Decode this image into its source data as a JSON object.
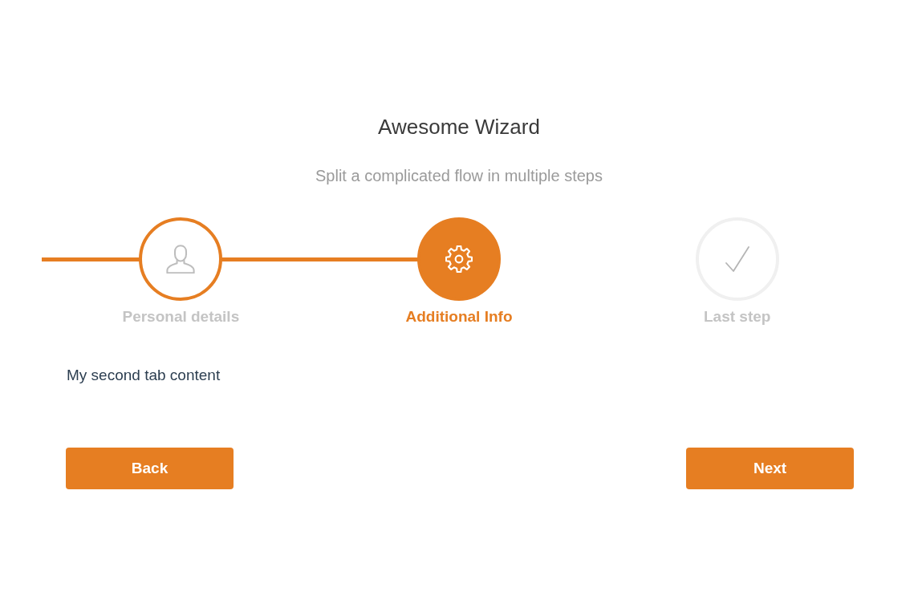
{
  "wizard": {
    "title": "Awesome Wizard",
    "subtitle": "Split a complicated flow in multiple steps"
  },
  "steps": [
    {
      "label": "Personal details",
      "selected": false,
      "visited": true
    },
    {
      "label": "Additional Info",
      "selected": true,
      "visited": true
    },
    {
      "label": "Last step",
      "selected": false,
      "visited": false
    }
  ],
  "content": "My second tab content",
  "buttons": [
    {
      "label": "Back"
    },
    {
      "label": "Next"
    }
  ]
}
